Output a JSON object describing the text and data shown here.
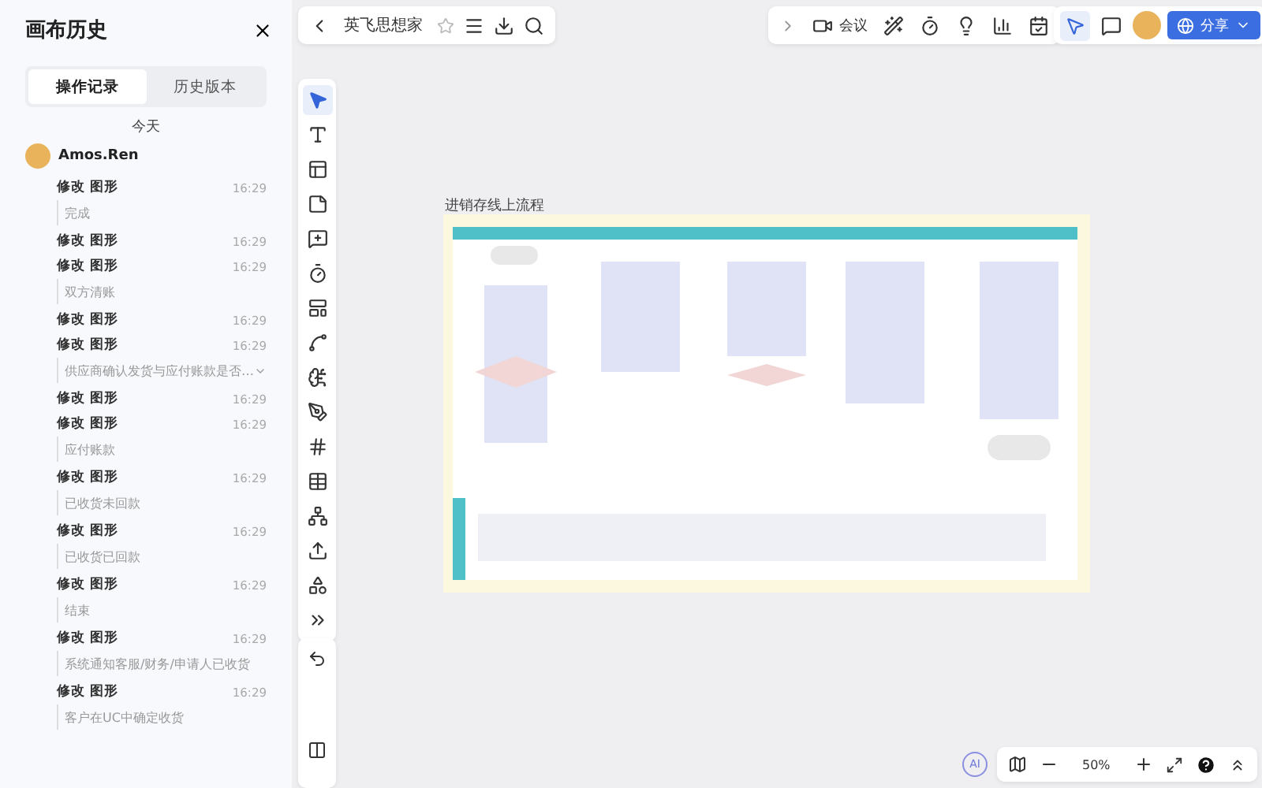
{
  "sidebar": {
    "title": "画布历史",
    "tabs": [
      {
        "label": "操作记录",
        "selected": true
      },
      {
        "label": "历史版本",
        "selected": false
      }
    ],
    "day": "今天",
    "user": "Amos.Ren",
    "entries": [
      {
        "action": "修改 图形",
        "time": "16:29",
        "detail": "完成"
      },
      {
        "action": "修改 图形",
        "time": "16:29"
      },
      {
        "action": "修改 图形",
        "time": "16:29",
        "detail": "双方清账"
      },
      {
        "action": "修改 图形",
        "time": "16:29"
      },
      {
        "action": "修改 图形",
        "time": "16:29",
        "detail": "供应商确认发货与应付账款是否…",
        "expanded": false
      },
      {
        "action": "修改 图形",
        "time": "16:29"
      },
      {
        "action": "修改 图形",
        "time": "16:29",
        "detail": "应付账款"
      },
      {
        "action": "修改 图形",
        "time": "16:29",
        "detail": "已收货未回款"
      },
      {
        "action": "修改 图形",
        "time": "16:29",
        "detail": "已收货已回款"
      },
      {
        "action": "修改 图形",
        "time": "16:29",
        "detail": "结束"
      },
      {
        "action": "修改 图形",
        "time": "16:29",
        "detail": "系统通知客服/财务/申请人已收货"
      },
      {
        "action": "修改 图形",
        "time": "16:29",
        "detail": "客户在UC中确定收货"
      }
    ]
  },
  "topbar": {
    "board_title": "英飞思想家",
    "meeting": "会议",
    "share": "分享"
  },
  "canvas": {
    "caption": "进销存线上流程"
  },
  "zoombar": {
    "ai": "AI",
    "zoom": "50%"
  }
}
